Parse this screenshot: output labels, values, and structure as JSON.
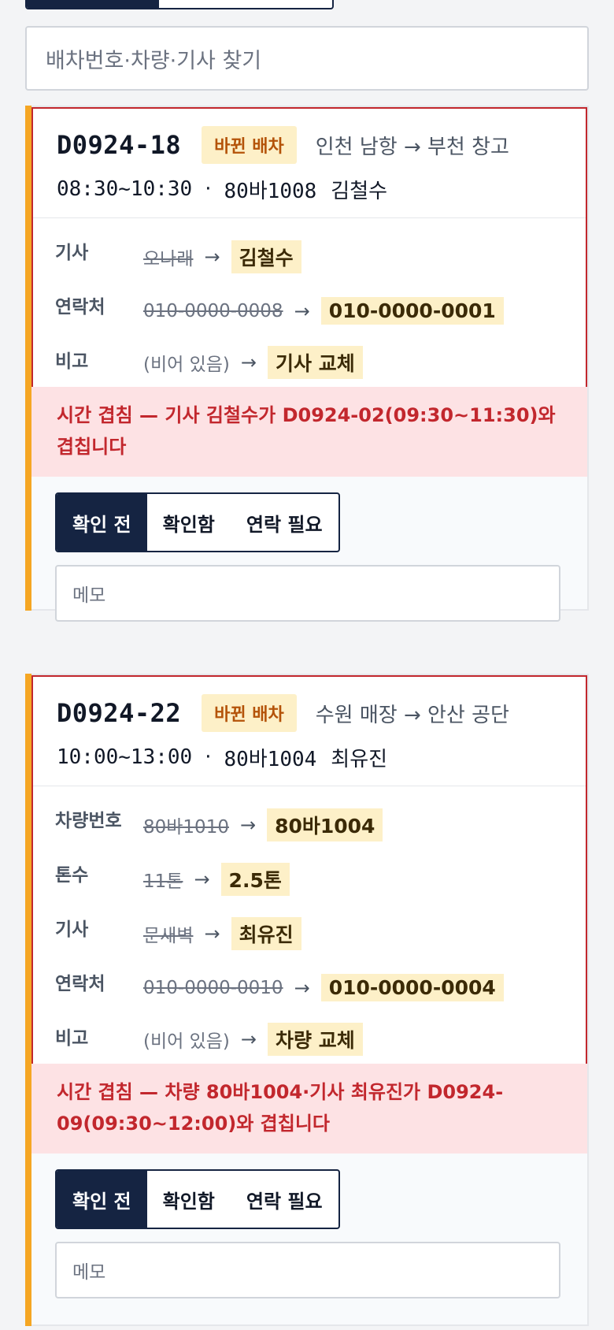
{
  "search": {
    "placeholder": "배차번호·차량·기사 찾기"
  },
  "cards": [
    {
      "dispatch_id": "D0924-18",
      "badge": "바뀐 배차",
      "route": "인천 남항 → 부천 창고",
      "time": "08:30~10:30",
      "separator": "·",
      "plate": "80바1008",
      "driver": "김철수",
      "changes": [
        {
          "label": "기사",
          "old": "오나래",
          "arrow": "→",
          "new": "김철수"
        },
        {
          "label": "연락처",
          "old": "010-0000-0008",
          "arrow": "→",
          "new": "010-0000-0001"
        },
        {
          "label": "비고",
          "old": "(비어 있음)",
          "arrow": "→",
          "new": "기사 교체"
        }
      ],
      "warning_line1": "시간 겹침 — 기사 김철수가 D0924-02(09:30~11:30)와",
      "warning_line2": "겹칩니다",
      "status_options": [
        "확인 전",
        "확인함",
        "연락 필요"
      ],
      "memo_placeholder": "메모"
    },
    {
      "dispatch_id": "D0924-22",
      "badge": "바뀐 배차",
      "route": "수원 매장 → 안산 공단",
      "time": "10:00~13:00",
      "separator": "·",
      "plate": "80바1004",
      "driver": "최유진",
      "changes": [
        {
          "label": "차량번호",
          "old": "80바1010",
          "arrow": "→",
          "new": "80바1004"
        },
        {
          "label": "톤수",
          "old": "11톤",
          "arrow": "→",
          "new": "2.5톤"
        },
        {
          "label": "기사",
          "old": "문새벽",
          "arrow": "→",
          "new": "최유진"
        },
        {
          "label": "연락처",
          "old": "010-0000-0010",
          "arrow": "→",
          "new": "010-0000-0004"
        },
        {
          "label": "비고",
          "old": "(비어 있음)",
          "arrow": "→",
          "new": "차량 교체"
        }
      ],
      "warning_line1": "시간 겹침 — 차량 80바1004·기사 최유진가 D0924-",
      "warning_line2": "09(09:30~12:00)와 겹칩니다",
      "status_options": [
        "확인 전",
        "확인함",
        "연락 필요"
      ],
      "memo_placeholder": "메모"
    }
  ],
  "colors": {
    "accent": "#f5a623",
    "navy": "#152442",
    "conflict_text": "#c2272d",
    "conflict_bg": "#fde2e4",
    "highlight_bg": "#fdf0c8"
  }
}
